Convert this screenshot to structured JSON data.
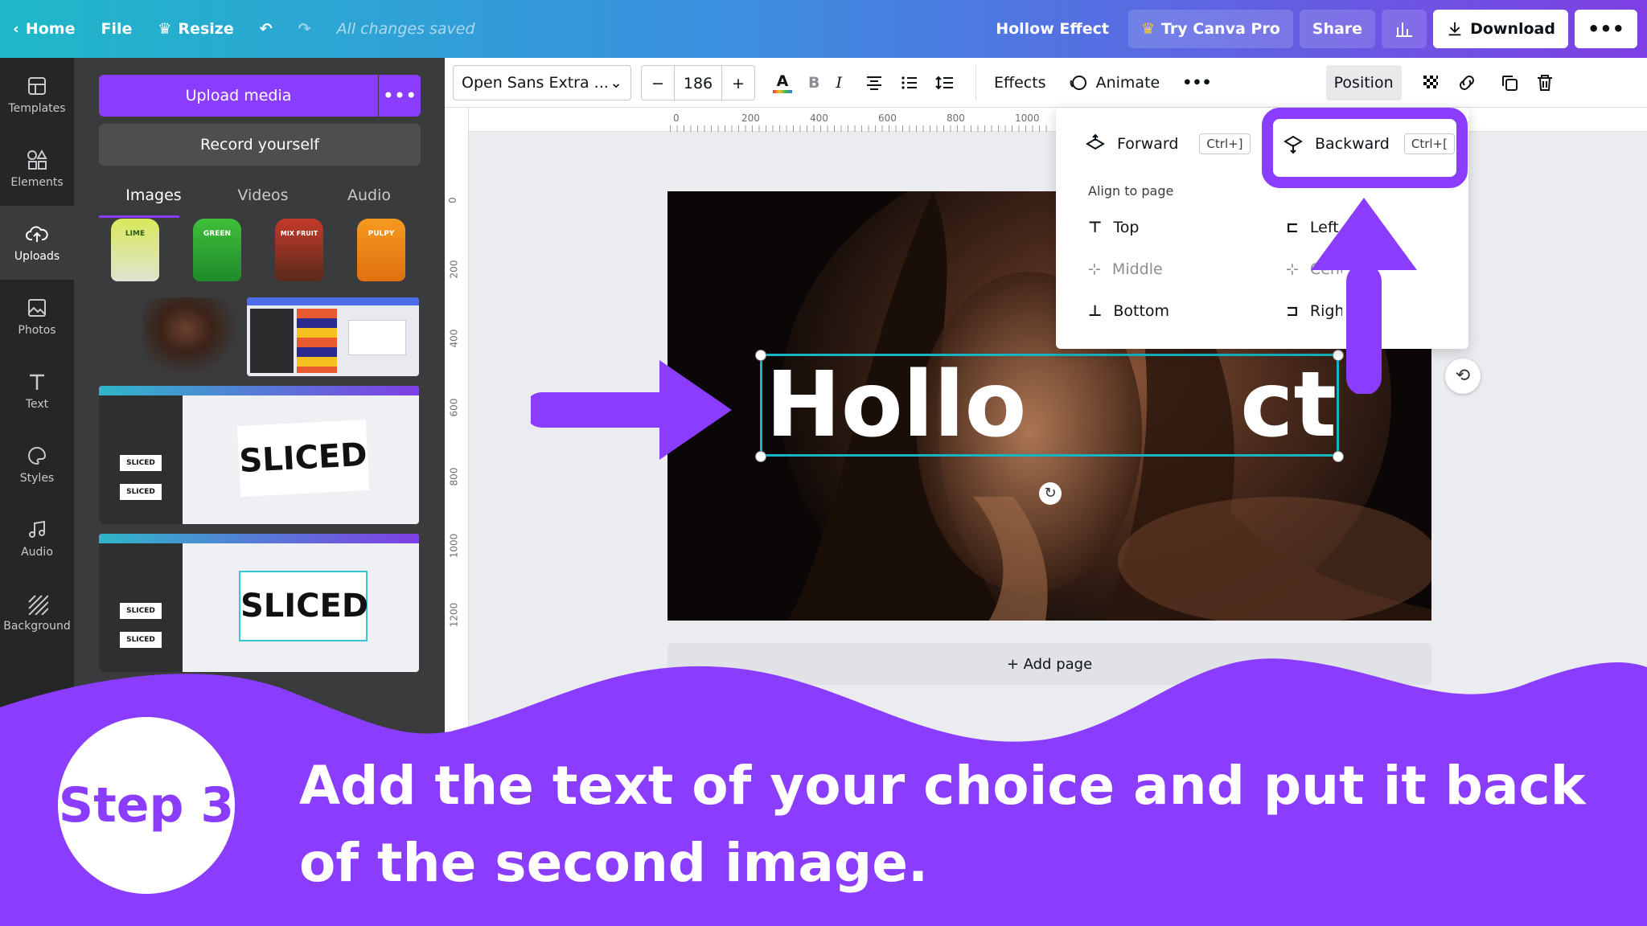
{
  "topbar": {
    "home": "Home",
    "file": "File",
    "resize": "Resize",
    "saved": "All changes saved",
    "design_title": "Hollow Effect",
    "try_pro": "Try Canva Pro",
    "share": "Share",
    "download": "Download"
  },
  "rail": {
    "items": [
      {
        "label": "Templates"
      },
      {
        "label": "Elements"
      },
      {
        "label": "Uploads"
      },
      {
        "label": "Photos"
      },
      {
        "label": "Text"
      },
      {
        "label": "Styles"
      },
      {
        "label": "Audio"
      },
      {
        "label": "Background"
      }
    ]
  },
  "panel": {
    "upload_media": "Upload media",
    "record_yourself": "Record yourself",
    "tabs": [
      "Images",
      "Videos",
      "Audio"
    ],
    "bottles": [
      "LIME",
      "GREEN",
      "MIX FRUIT",
      "PULPY"
    ],
    "thumb_word": "SLICED"
  },
  "toolbar": {
    "font": "Open Sans Extra ...",
    "font_size": "186",
    "effects": "Effects",
    "animate": "Animate",
    "position": "Position"
  },
  "ruler": {
    "top": [
      "0",
      "200",
      "400",
      "600",
      "800",
      "1000"
    ],
    "left": [
      "0",
      "200",
      "400",
      "600",
      "800",
      "1000",
      "1200"
    ]
  },
  "canvas": {
    "text_visible": "Hollo",
    "text_visible_end": "ct",
    "add_page": "+ Add page"
  },
  "menu": {
    "forward": "Forward",
    "forward_kbd": "Ctrl+]",
    "backward": "Backward",
    "backward_kbd": "Ctrl+[",
    "align_title": "Align to page",
    "top": "Top",
    "middle": "Middle",
    "bottom": "Bottom",
    "left": "Left",
    "center": "Center",
    "right": "Right"
  },
  "overlay": {
    "step": "Step 3",
    "caption": "Add the text of your choice and put it back of the second image."
  },
  "colors": {
    "accent": "#8b3dff",
    "selection": "#18b4c4"
  }
}
